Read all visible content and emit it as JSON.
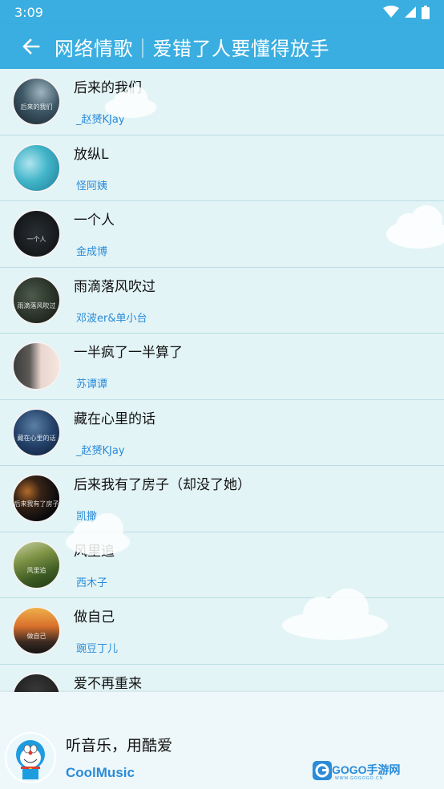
{
  "status_bar": {
    "time": "3:09"
  },
  "app_bar": {
    "title": "网络情歌｜爱错了人要懂得放手"
  },
  "songs": [
    {
      "title": "后来的我们",
      "artist": "_赵赟KJay",
      "cover_text": "后来的我们"
    },
    {
      "title": "放纵L",
      "artist": "怪阿姨",
      "cover_text": ""
    },
    {
      "title": "一个人",
      "artist": "金成博",
      "cover_text": "一个人"
    },
    {
      "title": "雨滴落风吹过",
      "artist": "邓波er&单小台",
      "cover_text": "雨滴落风吹过"
    },
    {
      "title": "一半疯了一半算了",
      "artist": "苏谭谭",
      "cover_text": ""
    },
    {
      "title": "藏在心里的话",
      "artist": "_赵赟KJay",
      "cover_text": "藏在心里的话"
    },
    {
      "title": "后来我有了房子（却没了她）",
      "artist": "凯撒",
      "cover_text": "后来我有了房子"
    },
    {
      "title": "风里追",
      "artist": "西木子",
      "cover_text": "风里追"
    },
    {
      "title": "做自己",
      "artist": "豌豆丁儿",
      "cover_text": "做自己"
    },
    {
      "title": "爱不再重来",
      "artist": "",
      "cover_text": ""
    }
  ],
  "footer": {
    "slogan": "听音乐，用酷爱",
    "brand": "CoolMusic",
    "watermark": "GOGO手游网",
    "watermark_sub": "WWW.GOGOGO.CN"
  },
  "colors": {
    "accent": "#3aaee0",
    "background": "#e3f4f6",
    "artist_text": "#2a8bd8",
    "divider": "#b8dde3"
  },
  "icons": {
    "status": [
      "wifi-icon",
      "signal-icon",
      "battery-icon"
    ],
    "back": "arrow-left-icon",
    "logo": "doraemon-logo"
  }
}
